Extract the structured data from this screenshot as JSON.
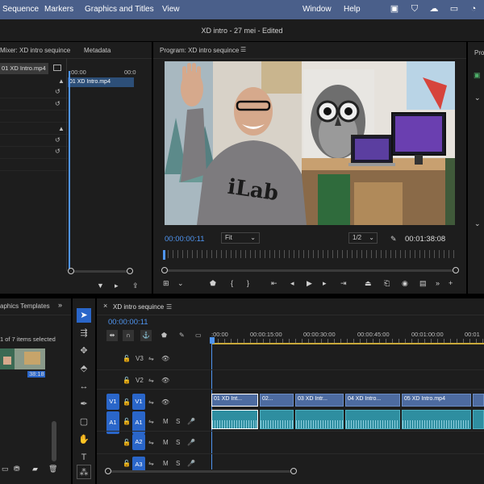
{
  "menubar": {
    "items": [
      "Sequence",
      "Markers",
      "Graphics and Titles",
      "View",
      "Window",
      "Help"
    ]
  },
  "window_title": "XD intro - 27 mei - Edited",
  "left_panel": {
    "tab_mixer": "Mixer: XD intro sequince",
    "tab_metadata": "Metadata",
    "clip_name": "01 XD Intro.mp4",
    "clip_name_right": "01 XD Intro.mp4",
    "ruler_start": ":00:00",
    "ruler_end": "00:0"
  },
  "program": {
    "title": "Program: XD intro sequince",
    "timecode_current": "00:00:00:11",
    "fit": "Fit",
    "resolution": "1/2",
    "timecode_duration": "00:01:38:08"
  },
  "right_strip": {
    "label": "Pro"
  },
  "project": {
    "tab": "aphics Templates",
    "selection": "1 of 7 items selected",
    "duration": "38:18"
  },
  "timeline": {
    "tab": "XD intro sequince",
    "timecode": "00:00:00:11",
    "ruler": [
      ":00:00",
      "00:00:15:00",
      "00:00:30:00",
      "00:00:45:00",
      "00:01:00:00",
      "00:01"
    ],
    "tracks": {
      "v3": "V3",
      "v2": "V2",
      "v1": "V1",
      "a1": "A1",
      "a2": "A2",
      "a3": "A3",
      "v1_src": "V1",
      "a1_src": "A1"
    },
    "mute": "M",
    "solo": "S",
    "clips": [
      "01 XD Int...",
      "02...",
      "03 XD Intr...",
      "04 XD Intro...",
      "05 XD Intro.mp4"
    ]
  },
  "video_text": {
    "sweatshirt": "iLab"
  },
  "colors": {
    "accent_blue": "#4f95f0",
    "menubar": "#4a5f8a",
    "clip_video": "#4d6ba0",
    "clip_audio": "#2e8ea0"
  }
}
